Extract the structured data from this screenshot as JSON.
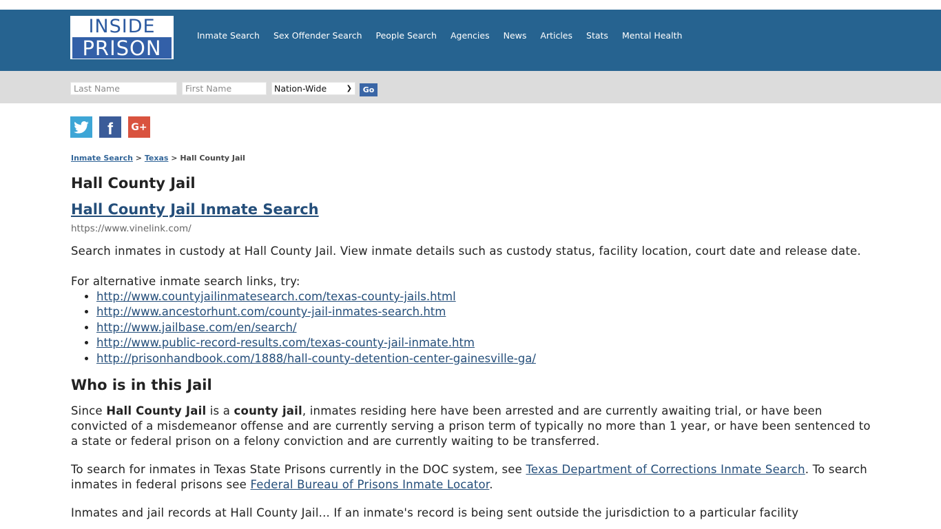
{
  "logo": {
    "line1": "INSIDE",
    "line2": "PRISON"
  },
  "nav": [
    "Inmate Search",
    "Sex Offender Search",
    "People Search",
    "Agencies",
    "News",
    "Articles",
    "Stats",
    "Mental Health"
  ],
  "search": {
    "last_placeholder": "Last Name",
    "first_placeholder": "First Name",
    "scope_selected": "Nation-Wide",
    "go_label": "Go"
  },
  "social": {
    "twitter": "twitter-icon",
    "facebook": "f",
    "google": "G+"
  },
  "breadcrumb": {
    "item1": "Inmate Search",
    "sep": ">",
    "item2": "Texas",
    "current": "Hall County Jail"
  },
  "page_title": "Hall County Jail",
  "result": {
    "title": "Hall County Jail Inmate Search",
    "url": "https://www.vinelink.com/",
    "description": "Search inmates in custody at Hall County Jail. View inmate details such as custody status, facility location, court date and release date."
  },
  "alt_links": {
    "intro": "For alternative inmate search links, try:",
    "links": [
      "http://www.countyjailinmatesearch.com/texas-county-jails.html",
      "http://www.ancestorhunt.com/county-jail-inmates-search.htm",
      "http://www.jailbase.com/en/search/",
      "http://www.public-record-results.com/texas-county-jail-inmate.htm",
      "http://prisonhandbook.com/1888/hall-county-detention-center-gainesville-ga/"
    ]
  },
  "who": {
    "heading": "Who is in this Jail",
    "p1_a": "Since ",
    "p1_b": "Hall County Jail",
    "p1_c": " is a ",
    "p1_d": "county jail",
    "p1_e": ", inmates residing here have been arrested and are currently awaiting trial, or have been convicted of a misdemeanor offense and are currently serving a prison term of typically no more than 1 year, or have been sentenced to a state or federal prison on a felony conviction and are currently waiting to be transferred.",
    "p2_a": "To search for inmates in Texas State Prisons currently in the DOC system, see ",
    "p2_link1": "Texas Department of Corrections Inmate Search",
    "p2_b": ". To search inmates in federal prisons see ",
    "p2_link2": "Federal Bureau of Prisons Inmate Locator",
    "p2_c": ".",
    "p3_partial": "Inmates and jail records at Hall County Jail... If an inmate's record is being sent outside the jurisdiction to a particular facility"
  }
}
